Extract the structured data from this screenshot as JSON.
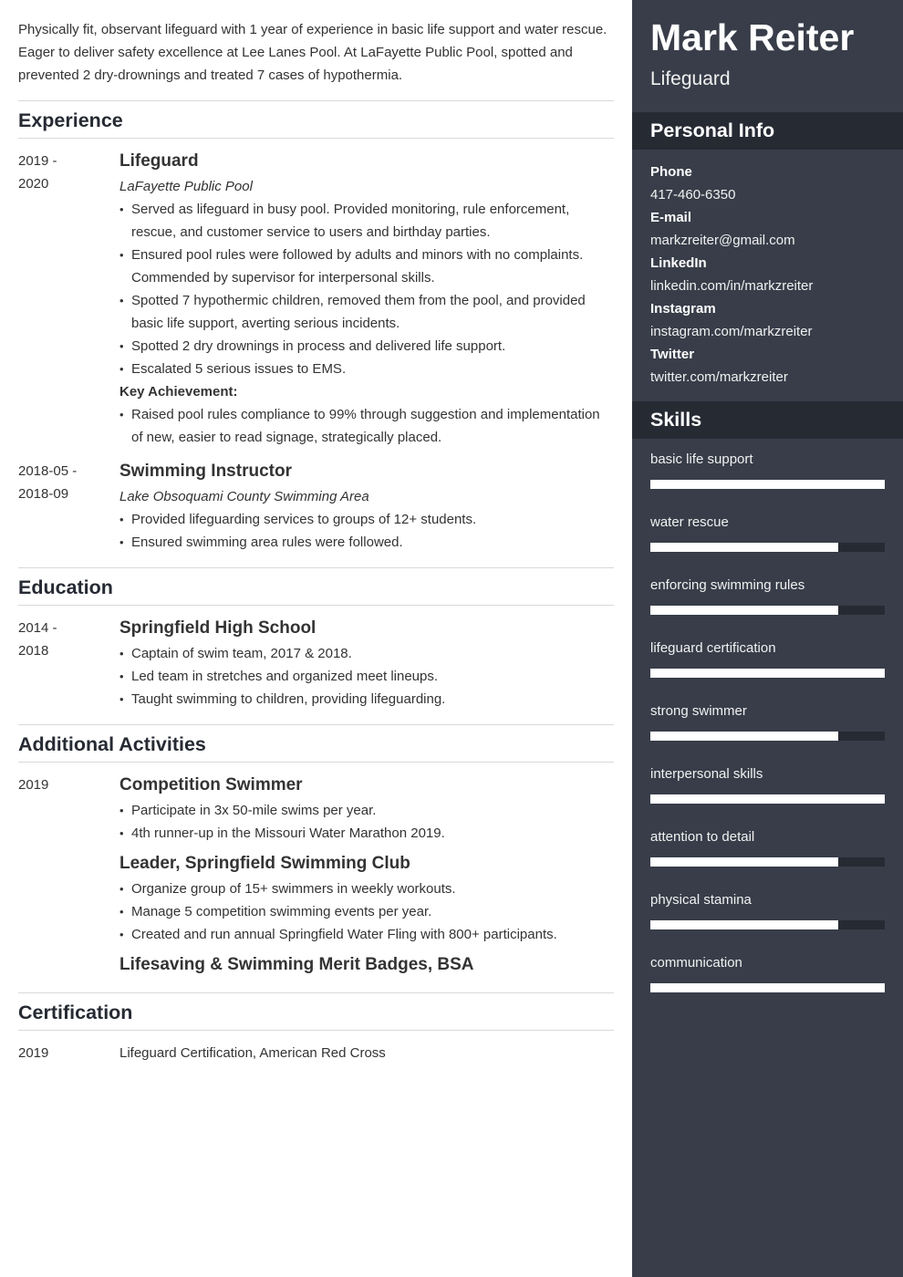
{
  "summary": "Physically fit, observant lifeguard with 1 year of experience in basic life support and water rescue. Eager to deliver safety excellence at Lee Lanes Pool. At LaFayette Public Pool, spotted and prevented 2 dry-drownings and treated 7 cases of hypothermia.",
  "experience": {
    "title": "Experience",
    "entries": [
      {
        "date_start": "2019 -",
        "date_end": "2020",
        "title": "Lifeguard",
        "company": "LaFayette Public Pool",
        "bullets": [
          "Served as lifeguard in busy pool. Provided monitoring, rule enforcement, rescue, and customer service to users and birthday parties.",
          "Ensured pool rules were followed by adults and minors with no complaints. Commended by supervisor for interpersonal skills.",
          "Spotted 7 hypothermic children, removed them from the pool, and provided basic life support, averting serious incidents.",
          "Spotted 2 dry drownings in process and delivered life support.",
          "Escalated 5 serious issues to EMS."
        ],
        "key_label": "Key Achievement:",
        "key_bullets": [
          "Raised pool rules compliance to 99% through suggestion and implementation of new, easier to read signage, strategically placed."
        ]
      },
      {
        "date_start": "2018-05 -",
        "date_end": "2018-09",
        "title": "Swimming Instructor",
        "company": "Lake Obsoquami County Swimming Area",
        "bullets": [
          "Provided lifeguarding services to groups of 12+ students.",
          "Ensured swimming area rules were followed."
        ]
      }
    ]
  },
  "education": {
    "title": "Education",
    "entries": [
      {
        "date_start": "2014 -",
        "date_end": "2018",
        "title": "Springfield High School",
        "bullets": [
          "Captain of swim team, 2017 & 2018.",
          "Led team in stretches and organized meet lineups.",
          "Taught swimming to children, providing lifeguarding."
        ]
      }
    ]
  },
  "activities": {
    "title": "Additional Activities",
    "date": "2019",
    "items": [
      {
        "title": "Competition Swimmer",
        "bullets": [
          "Participate in 3x 50-mile swims per year.",
          "4th runner-up in the Missouri Water Marathon 2019."
        ]
      },
      {
        "title": "Leader, Springfield Swimming Club",
        "bullets": [
          "Organize group of 15+ swimmers in weekly workouts.",
          "Manage 5 competition swimming events per year.",
          "Created and run annual Springfield Water Fling with 800+ participants."
        ]
      },
      {
        "title": "Lifesaving & Swimming Merit Badges, BSA",
        "bullets": []
      }
    ]
  },
  "certification": {
    "title": "Certification",
    "date": "2019",
    "text": "Lifeguard Certification, American Red Cross"
  },
  "sidebar": {
    "name": "Mark Reiter",
    "role": "Lifeguard",
    "personal_info_title": "Personal Info",
    "personal_info": [
      {
        "label": "Phone",
        "value": "417-460-6350"
      },
      {
        "label": "E-mail",
        "value": "markzreiter@gmail.com"
      },
      {
        "label": "LinkedIn",
        "value": "linkedin.com/in/markzreiter"
      },
      {
        "label": "Instagram",
        "value": "instagram.com/markzreiter"
      },
      {
        "label": "Twitter",
        "value": "twitter.com/markzreiter"
      }
    ],
    "skills_title": "Skills",
    "skills": [
      {
        "name": "basic life support",
        "level": 1.0
      },
      {
        "name": "water rescue",
        "level": 0.8
      },
      {
        "name": "enforcing swimming rules",
        "level": 0.8
      },
      {
        "name": "lifeguard certification",
        "level": 1.0
      },
      {
        "name": "strong swimmer",
        "level": 0.8
      },
      {
        "name": "interpersonal skills",
        "level": 1.0
      },
      {
        "name": "attention to detail",
        "level": 0.8
      },
      {
        "name": "physical stamina",
        "level": 0.8
      },
      {
        "name": "communication",
        "level": 1.0
      }
    ]
  },
  "colors": {
    "sidebar_bg": "#383d49",
    "sidebar_header_bg": "#262a33",
    "skill_fill": "#ffffff",
    "skill_track": "#262a33",
    "heading": "#262a33"
  }
}
